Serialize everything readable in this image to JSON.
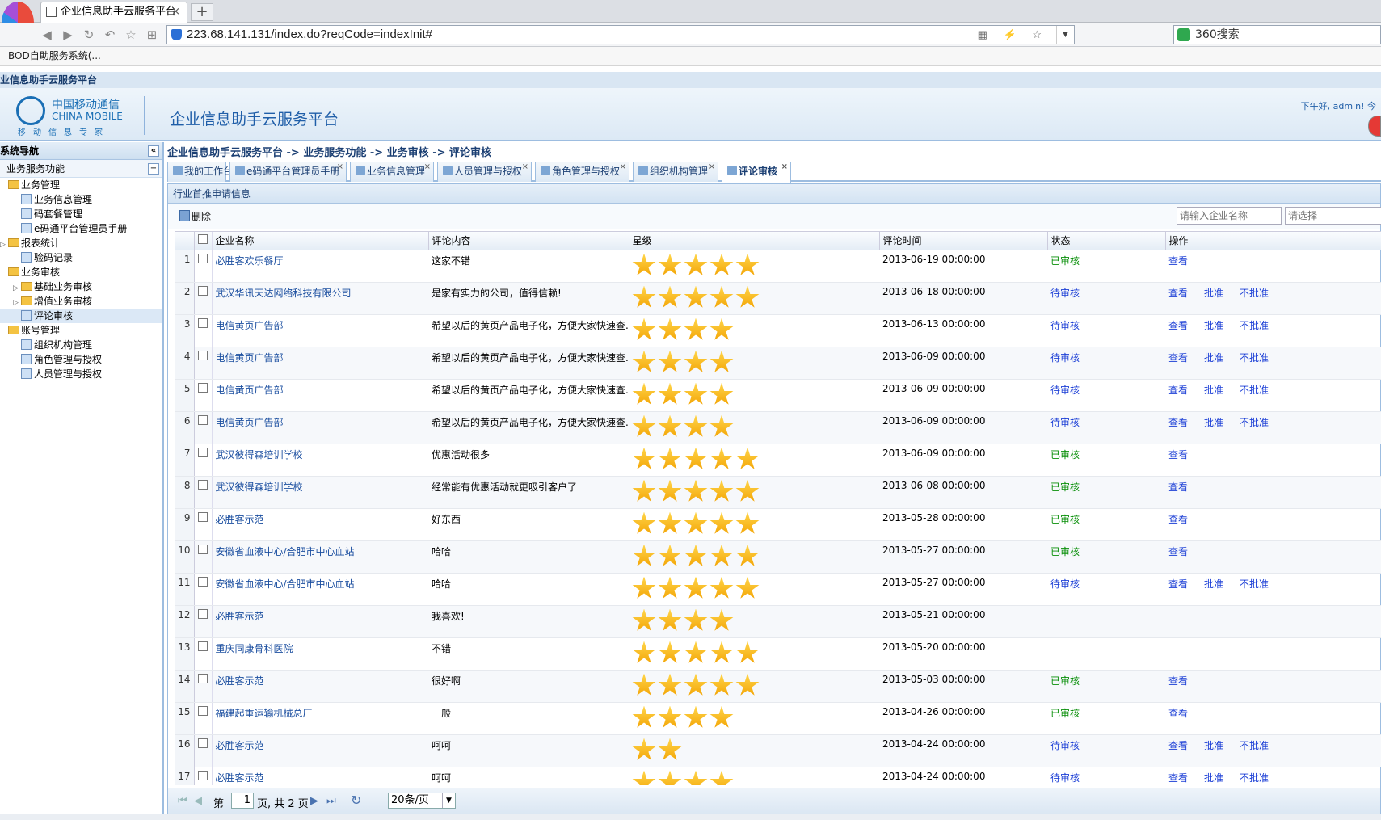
{
  "browser": {
    "tab_title": "企业信息助手云服务平台",
    "tab_close": "×",
    "new_tab": "+",
    "url": "223.68.141.131/index.do?reqCode=indexInit#",
    "search_engine": "360搜索",
    "bookmark": "BOD自助服务系统(..."
  },
  "app": {
    "title_bar": "业信息助手云服务平台",
    "banner_title": "企业信息助手云服务平台",
    "logo_cn": "中国移动通信",
    "logo_en": "CHINA MOBILE",
    "logo_sub": "移动信息专家",
    "greeting": "下午好, admin! 今"
  },
  "sidebar": {
    "header": "系统导航",
    "collapse": "«",
    "section": "业务服务功能",
    "section_toggle": "−",
    "items": [
      {
        "label": "业务管理",
        "level": 0,
        "type": "folder",
        "exp": ""
      },
      {
        "label": "业务信息管理",
        "level": 1,
        "type": "leaf"
      },
      {
        "label": "码套餐管理",
        "level": 1,
        "type": "leaf"
      },
      {
        "label": "e码通平台管理员手册",
        "level": 1,
        "type": "leaf"
      },
      {
        "label": "报表统计",
        "level": 0,
        "type": "folder",
        "exp": "▷"
      },
      {
        "label": "验码记录",
        "level": 1,
        "type": "leaf"
      },
      {
        "label": "业务审核",
        "level": 0,
        "type": "folder",
        "exp": ""
      },
      {
        "label": "基础业务审核",
        "level": 1,
        "type": "folder",
        "exp": "▷"
      },
      {
        "label": "增值业务审核",
        "level": 1,
        "type": "folder",
        "exp": "▷"
      },
      {
        "label": "评论审核",
        "level": 1,
        "type": "leaf",
        "selected": true
      },
      {
        "label": "账号管理",
        "level": 0,
        "type": "folder",
        "exp": ""
      },
      {
        "label": "组织机构管理",
        "level": 1,
        "type": "leaf"
      },
      {
        "label": "角色管理与授权",
        "level": 1,
        "type": "leaf"
      },
      {
        "label": "人员管理与授权",
        "level": 1,
        "type": "leaf"
      }
    ]
  },
  "breadcrumb": "企业信息助手云服务平台 -> 业务服务功能 -> 业务审核 -> 评论审核",
  "tabs": [
    {
      "label": "我的工作台",
      "closable": false,
      "active": false
    },
    {
      "label": "e码通平台管理员手册",
      "closable": true,
      "active": false
    },
    {
      "label": "业务信息管理",
      "closable": true,
      "active": false
    },
    {
      "label": "人员管理与授权",
      "closable": true,
      "active": false
    },
    {
      "label": "角色管理与授权",
      "closable": true,
      "active": false
    },
    {
      "label": "组织机构管理",
      "closable": true,
      "active": false
    },
    {
      "label": "评论审核",
      "closable": true,
      "active": true
    }
  ],
  "tab_close": "×",
  "panel": {
    "title": "行业首推申请信息",
    "delete_label": "删除",
    "search_placeholder": "请输入企业名称",
    "filter_placeholder": "请选择"
  },
  "grid": {
    "columns": [
      "企业名称",
      "评论内容",
      "星级",
      "评论时间",
      "状态",
      "操作"
    ],
    "rows": [
      {
        "n": "1",
        "company": "必胜客欢乐餐厅",
        "comment": "这家不错",
        "stars": 5,
        "time": "2013-06-19 00:00:00",
        "status": "已审核",
        "ops": [
          "查看"
        ]
      },
      {
        "n": "2",
        "company": "武汉华讯天达网络科技有限公司",
        "comment": "是家有实力的公司，值得信赖!",
        "stars": 5,
        "time": "2013-06-18 00:00:00",
        "status": "待审核",
        "ops": [
          "查看",
          "批准",
          "不批准"
        ]
      },
      {
        "n": "3",
        "company": "电信黄页广告部",
        "comment": "希望以后的黄页产品电子化，方便大家快速查...",
        "stars": 4,
        "time": "2013-06-13 00:00:00",
        "status": "待审核",
        "ops": [
          "查看",
          "批准",
          "不批准"
        ]
      },
      {
        "n": "4",
        "company": "电信黄页广告部",
        "comment": "希望以后的黄页产品电子化，方便大家快速查...",
        "stars": 4,
        "time": "2013-06-09 00:00:00",
        "status": "待审核",
        "ops": [
          "查看",
          "批准",
          "不批准"
        ]
      },
      {
        "n": "5",
        "company": "电信黄页广告部",
        "comment": "希望以后的黄页产品电子化，方便大家快速查...",
        "stars": 4,
        "time": "2013-06-09 00:00:00",
        "status": "待审核",
        "ops": [
          "查看",
          "批准",
          "不批准"
        ]
      },
      {
        "n": "6",
        "company": "电信黄页广告部",
        "comment": "希望以后的黄页产品电子化，方便大家快速查...",
        "stars": 4,
        "time": "2013-06-09 00:00:00",
        "status": "待审核",
        "ops": [
          "查看",
          "批准",
          "不批准"
        ]
      },
      {
        "n": "7",
        "company": "武汉彼得森培训学校",
        "comment": "优惠活动很多",
        "stars": 5,
        "time": "2013-06-09 00:00:00",
        "status": "已审核",
        "ops": [
          "查看"
        ]
      },
      {
        "n": "8",
        "company": "武汉彼得森培训学校",
        "comment": "经常能有优惠活动就更吸引客户了",
        "stars": 5,
        "time": "2013-06-08 00:00:00",
        "status": "已审核",
        "ops": [
          "查看"
        ]
      },
      {
        "n": "9",
        "company": "必胜客示范",
        "comment": "好东西",
        "stars": 5,
        "time": "2013-05-28 00:00:00",
        "status": "已审核",
        "ops": [
          "查看"
        ]
      },
      {
        "n": "10",
        "company": "安徽省血液中心/合肥市中心血站",
        "comment": "哈哈",
        "stars": 5,
        "time": "2013-05-27 00:00:00",
        "status": "已审核",
        "ops": [
          "查看"
        ]
      },
      {
        "n": "11",
        "company": "安徽省血液中心/合肥市中心血站",
        "comment": "哈哈",
        "stars": 5,
        "time": "2013-05-27 00:00:00",
        "status": "待审核",
        "ops": [
          "查看",
          "批准",
          "不批准"
        ]
      },
      {
        "n": "12",
        "company": "必胜客示范",
        "comment": "我喜欢!",
        "stars": 4,
        "time": "2013-05-21 00:00:00",
        "status": "",
        "ops": []
      },
      {
        "n": "13",
        "company": "重庆同康骨科医院",
        "comment": "不错",
        "stars": 5,
        "time": "2013-05-20 00:00:00",
        "status": "",
        "ops": []
      },
      {
        "n": "14",
        "company": "必胜客示范",
        "comment": "很好啊",
        "stars": 5,
        "time": "2013-05-03 00:00:00",
        "status": "已审核",
        "ops": [
          "查看"
        ]
      },
      {
        "n": "15",
        "company": "福建起重运输机械总厂",
        "comment": "一般",
        "stars": 4,
        "time": "2013-04-26 00:00:00",
        "status": "已审核",
        "ops": [
          "查看"
        ]
      },
      {
        "n": "16",
        "company": "必胜客示范",
        "comment": "呵呵",
        "stars": 2,
        "time": "2013-04-24 00:00:00",
        "status": "待审核",
        "ops": [
          "查看",
          "批准",
          "不批准"
        ]
      },
      {
        "n": "17",
        "company": "必胜客示范",
        "comment": "呵呵",
        "stars": 4,
        "time": "2013-04-24 00:00:00",
        "status": "待审核",
        "ops": [
          "查看",
          "批准",
          "不批准"
        ]
      }
    ]
  },
  "pager": {
    "first": "⏮",
    "prev": "◀",
    "page_prefix": "第",
    "page": "1",
    "page_suffix": "页, 共 2 页",
    "next": "▶",
    "last": "⏭",
    "refresh": "↻",
    "per_page": "20条/页",
    "dropdown": "▼"
  },
  "colors": {
    "approved": "#0a8f0a",
    "pending": "#1c3fd6",
    "link": "#1c4fa0",
    "star": "#f2a100"
  }
}
